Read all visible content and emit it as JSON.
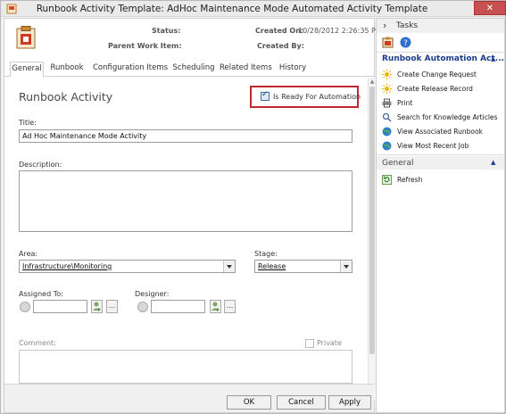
{
  "window": {
    "title": "Runbook Activity Template: AdHoc Maintenance Mode Automated Activity Template",
    "close_glyph": "✕"
  },
  "header": {
    "status_label": "Status:",
    "parent_label": "Parent Work Item:",
    "created_on_label": "Created On:",
    "created_on_value": "10/28/2012 2:26:35 PM",
    "created_by_label": "Created By:"
  },
  "tabs": [
    {
      "label": "General"
    },
    {
      "label": "Runbook"
    },
    {
      "label": "Configuration Items"
    },
    {
      "label": "Scheduling"
    },
    {
      "label": "Related Items"
    },
    {
      "label": "History"
    }
  ],
  "form": {
    "section_title": "Runbook Activity",
    "ready_label": "Is Ready For Automation",
    "ready_checked": true,
    "title_label": "Title:",
    "title_value": "Ad Hoc Maintenance Mode Activity",
    "description_label": "Description:",
    "area_label": "Area:",
    "area_value": "Infrastructure\\Monitoring",
    "stage_label": "Stage:",
    "stage_value": "Release",
    "assigned_label": "Assigned To:",
    "designer_label": "Designer:",
    "browse_label": "...",
    "comment_label": "Comment:",
    "private_label": "Private"
  },
  "footer": {
    "ok_label": "OK",
    "cancel_label": "Cancel",
    "apply_label": "Apply"
  },
  "tasks": {
    "header": "Tasks",
    "expand_glyph": "›",
    "group_title": "Runbook Automation Act...",
    "items": [
      {
        "label": "Create Change Request",
        "icon": "sun-icon"
      },
      {
        "label": "Create Release Record",
        "icon": "sun-icon"
      },
      {
        "label": "Print",
        "icon": "printer-icon"
      },
      {
        "label": "Search for Knowledge Articles",
        "icon": "search-icon"
      },
      {
        "label": "View Associated Runbook",
        "icon": "globe-icon"
      },
      {
        "label": "View Most Recent Job",
        "icon": "globe-icon"
      }
    ],
    "general_title": "General",
    "general_items": [
      {
        "label": "Refresh",
        "icon": "refresh-icon"
      }
    ],
    "collapse_glyph": "▲"
  },
  "colors": {
    "highlight_border": "#c0282d",
    "link_blue": "#1a3c8e"
  }
}
